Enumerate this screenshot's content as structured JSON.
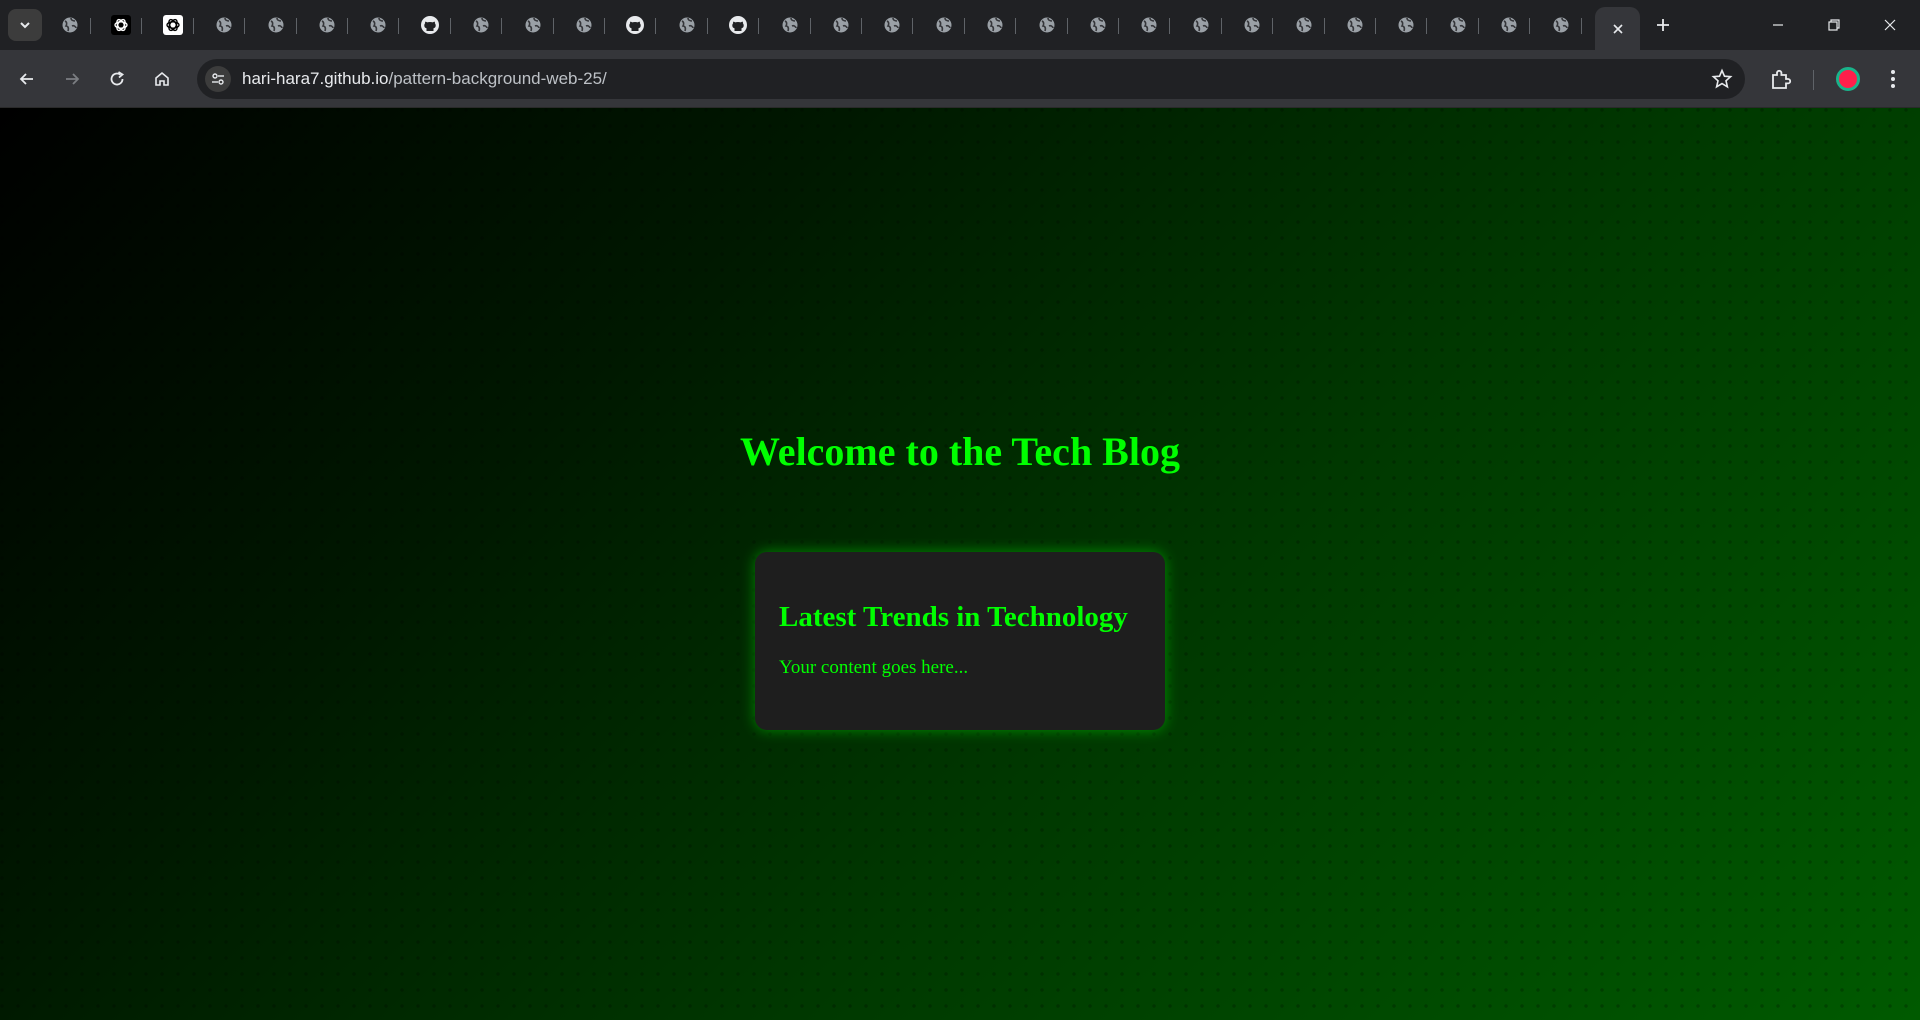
{
  "browser": {
    "tab_icons": [
      "globe-icon",
      "openai-icon",
      "openai-icon",
      "globe-icon",
      "globe-icon",
      "globe-icon",
      "globe-icon",
      "github-icon",
      "globe-icon",
      "globe-icon",
      "globe-icon",
      "github-icon",
      "globe-icon",
      "github-icon",
      "globe-icon",
      "globe-icon",
      "globe-icon",
      "globe-icon",
      "globe-icon",
      "globe-icon",
      "globe-icon",
      "globe-icon",
      "globe-icon",
      "globe-icon",
      "globe-icon",
      "globe-icon",
      "globe-icon",
      "globe-icon",
      "globe-icon",
      "globe-icon"
    ],
    "active_tab_icon": "close-icon",
    "address_bar": {
      "host": "hari-hara7.github.io",
      "path": "/pattern-background-web-25/"
    }
  },
  "page": {
    "title": "Welcome to the Tech Blog",
    "card": {
      "heading": "Latest Trends in Technology",
      "body": "Your content goes here..."
    }
  },
  "colors": {
    "accent_green": "#00ff00",
    "card_bg": "#1e1e1e",
    "profile_red": "#ff1f4b",
    "profile_ring": "#19b38a"
  }
}
